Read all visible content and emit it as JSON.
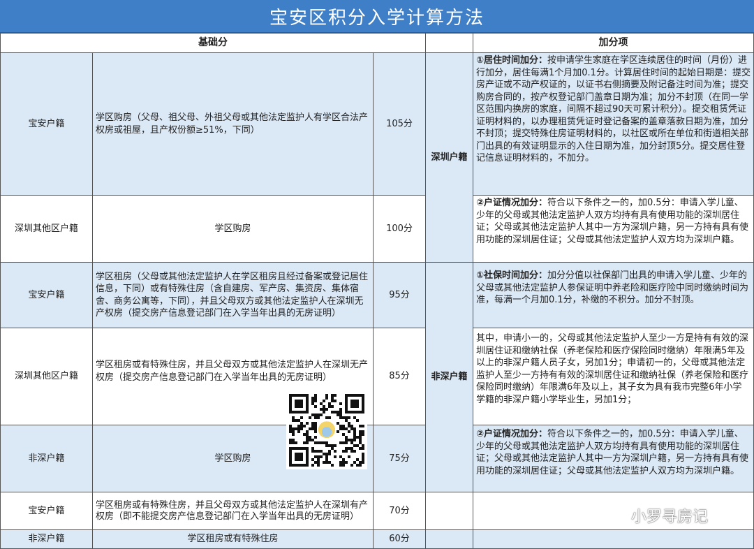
{
  "title": "宝安区积分入学计算方法",
  "headers": {
    "base": "基础分",
    "bonus": "加分项"
  },
  "base_rows": [
    {
      "category": "宝安户籍",
      "condition": "学区购房（父母、祖父母、外祖父母或其他法定监护人有学区合法产权房或祖屋，且产权份额≥51%，下同）",
      "score": "105分"
    },
    {
      "category": "深圳其他区户籍",
      "condition": "学区购房",
      "score": "100分"
    },
    {
      "category": "宝安户籍",
      "condition": "学区租房（父母或其他法定监护人在学区租房且经过备案或登记居住信息，下同）或有特殊住房（含自建房、军产房、集资房、集体宿舍、商务公寓等，下同），并且父母双方或其他法定监护人在深圳无产权房（提交房产信息登记部门在入学当年出具的无房证明）",
      "score": "95分"
    },
    {
      "category": "深圳其他区户籍",
      "condition": "学区租房或有特殊住房，并且父母双方或其他法定监护人在深圳无产权房（提交房产信息登记部门在入学当年出具的无房证明）",
      "score": "85分"
    },
    {
      "category": "非深户籍",
      "condition": "学区购房",
      "score": "75分"
    },
    {
      "category": "宝安户籍",
      "condition": "学区租房或有特殊住房，并且父母双方或其他法定监护人在深圳有产权房（即不能提交房产信息登记部门在入学当年出具的无房证明）",
      "score": "70分"
    },
    {
      "category": "非深户籍",
      "condition": "学区租房或有特殊住房",
      "score": "60分"
    }
  ],
  "bonus_groups": {
    "shenzhen": "深圳户籍",
    "non_shenzhen": "非深户籍"
  },
  "bonus_items": {
    "sz_residence_label": "①居住时间加分：",
    "sz_residence_text": "按申请学生家庭在学区连续居住的时间（月份）进行加分，居住每满1个月加0.1分。计算居住时间的起始日期是：提交房产证或不动产权证的，以证书右侧摘要及附记备注时间为准；提交购房合同的，按产权登记部门盖章日期为准；加分不封顶（在同一学区范围内换房的家庭，间隔不超过90天可累计积分）。提交租赁凭证证明材料的，以办理租赁凭证时登记备案的盖章落款日期为准，加分不封顶；提交特殊住房证明材料的，以社区或所在单位和街道相关部门出具的有效证明显示的入住日期为准，加分封顶5分。提交居住登记信息证明材料的，不加分。",
    "sz_hukou_label": "②户证情况加分：",
    "sz_hukou_text": "符合以下条件之一的，加0.5分：申请入学儿童、少年的父母或其他法定监护人双方均持有具有使用功能的深圳居住证；父母或其他法定监护人其中一方为深圳户籍，另一方持有具有使用功能的深圳居住证；父母或其他法定监护人双方均为深圳户籍。",
    "nsz_social_label": "①社保时间加分：",
    "nsz_social_text": "加分分值以社保部门出具的申请入学儿童、少年的父母或其他法定监护人参保证明中养老险和医疗险中同时缴纳时间为准，每满一个月加0.1分，补缴的不积分。加分不封顶。",
    "nsz_extra_text": "其中，申请小一的，父母或其他法定监护人至少一方是持有有效的深圳居住证和缴纳社保（养老保险和医疗保险同时缴纳）年限满5年及以上的非深户籍人员子女，另加1分；申请初一的，父母或其他法定监护人至少一方持有有效的深圳居住证和缴纳社保（养老保险和医疗保险同时缴纳）年限满6年及以上，其子女为具有我市完整6年小学学籍的非深户籍小学毕业生，另加1分；",
    "nsz_hukou_label": "②户证情况加分：",
    "nsz_hukou_text": "符合以下条件之一的，加0.5分：申请入学儿童、少年的父母或其他法定监护人双方均持有具有使用功能的深圳居住证；父母或其他法定监护人其中一方为深圳户籍，另一方持有具有使用功能的深圳居住证；父母或其他法定监护人双方均为深圳户籍。"
  },
  "watermark": "小罗寻房记",
  "icons": {
    "qr": "qr-code-icon",
    "wechat": "wechat-icon"
  },
  "colors": {
    "title_bg": "#3e7fc8",
    "cell_blue": "#dbe8f5",
    "border": "#555555"
  }
}
